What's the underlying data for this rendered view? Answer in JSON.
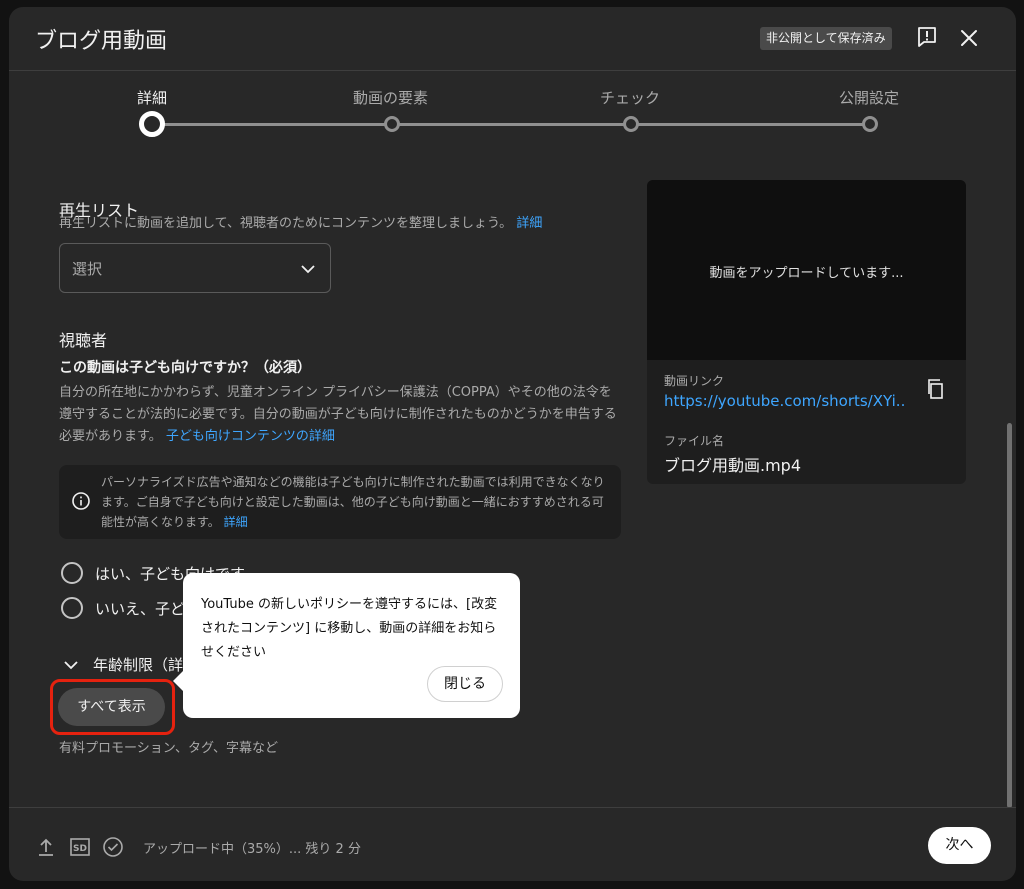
{
  "header": {
    "title": "ブログ用動画",
    "saved_badge": "非公開として保存済み"
  },
  "stepper": {
    "steps": [
      {
        "label": "詳細",
        "active": true
      },
      {
        "label": "動画の要素",
        "active": false
      },
      {
        "label": "チェック",
        "active": false
      },
      {
        "label": "公開設定",
        "active": false
      }
    ]
  },
  "playlist": {
    "title": "再生リスト",
    "description": "再生リストに動画を追加して、視聴者のためにコンテンツを整理しましょう。",
    "link": "詳細",
    "select_value": "選択"
  },
  "audience": {
    "title": "視聴者",
    "question": "この動画は子ども向けですか？（必須）",
    "description": "自分の所在地にかかわらず、児童オンライン プライバシー保護法（COPPA）やその他の法令を遵守することが法的に必要です。自分の動画が子ども向けに制作されたものかどうかを申告する必要があります。",
    "link": "子ども向けコンテンツの詳細",
    "info_text": "パーソナライズド広告や通知などの機能は子ども向けに制作された動画では利用できなくなります。ご自身で子ども向けと設定した動画は、他の子ども向け動画と一緒におすすめされる可能性が高くなります。",
    "info_link": "詳細",
    "option_yes": "はい、子ども向けです",
    "option_no": "いいえ、子ど",
    "age_restriction": "年齢制限（詳",
    "show_all": "すべて表示",
    "more_desc": "有料プロモーション、タグ、字幕など"
  },
  "side": {
    "preview_text": "動画をアップロードしています...",
    "link_label": "動画リンク",
    "link_value": "https://youtube.com/shorts/XYi...",
    "file_label": "ファイル名",
    "file_name": "ブログ用動画.mp4"
  },
  "tooltip": {
    "text": "YouTube の新しいポリシーを遵守するには、[改変されたコンテンツ] に移動し、動画の詳細をお知らせください",
    "close_label": "閉じる"
  },
  "footer": {
    "status": "アップロード中（35%）... 残り 2 分",
    "next_label": "次へ",
    "upload_progress": 0.35
  },
  "colors": {
    "accent_link": "#3ea6ff",
    "highlight": "#e5220f",
    "dialog_bg": "#282828"
  },
  "icons": [
    "feedback-icon",
    "close-icon",
    "chevron-down-icon",
    "info-icon",
    "copy-icon",
    "upload-icon",
    "sd-icon",
    "check-circle-icon"
  ]
}
